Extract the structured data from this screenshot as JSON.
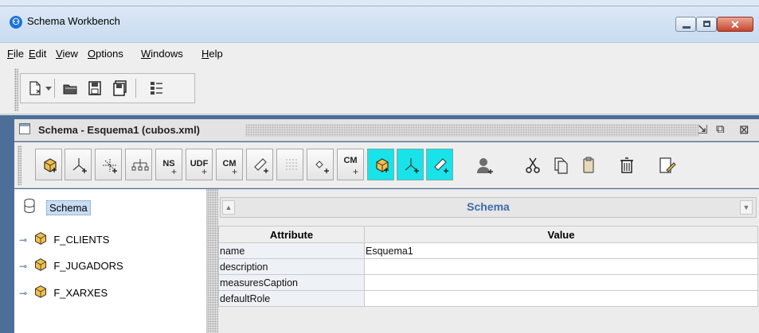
{
  "window": {
    "title": "Schema Workbench",
    "close_glyph": "✕"
  },
  "menubar": {
    "items": [
      {
        "underline": "F",
        "rest": "ile"
      },
      {
        "underline": "E",
        "rest": "dit"
      },
      {
        "underline": "V",
        "rest": "iew"
      },
      {
        "underline": "O",
        "rest": "ptions"
      },
      {
        "underline": "W",
        "rest": "indows"
      },
      {
        "underline": "H",
        "rest": "elp"
      }
    ]
  },
  "schema_frame": {
    "title": "Schema - Esquema1 (cubos.xml)",
    "toolbar_labels": {
      "ns": "NS",
      "udf": "UDF",
      "cm": "CM",
      "cm2": "CM"
    }
  },
  "tree": {
    "root": "Schema",
    "items": [
      "F_CLIENTS",
      "F_JUGADORS",
      "F_XARXES"
    ]
  },
  "panel": {
    "header": "Schema",
    "columns": [
      "Attribute",
      "Value"
    ],
    "rows": [
      {
        "attribute": "name",
        "value": "Esquema1"
      },
      {
        "attribute": "description",
        "value": ""
      },
      {
        "attribute": "measuresCaption",
        "value": ""
      },
      {
        "attribute": "defaultRole",
        "value": ""
      }
    ]
  },
  "colors": {
    "cube_icon": "#f1c04a",
    "highlight_button": "#18e3e8",
    "header_text": "#3f6ba8",
    "desktop": "#4b6f99"
  }
}
